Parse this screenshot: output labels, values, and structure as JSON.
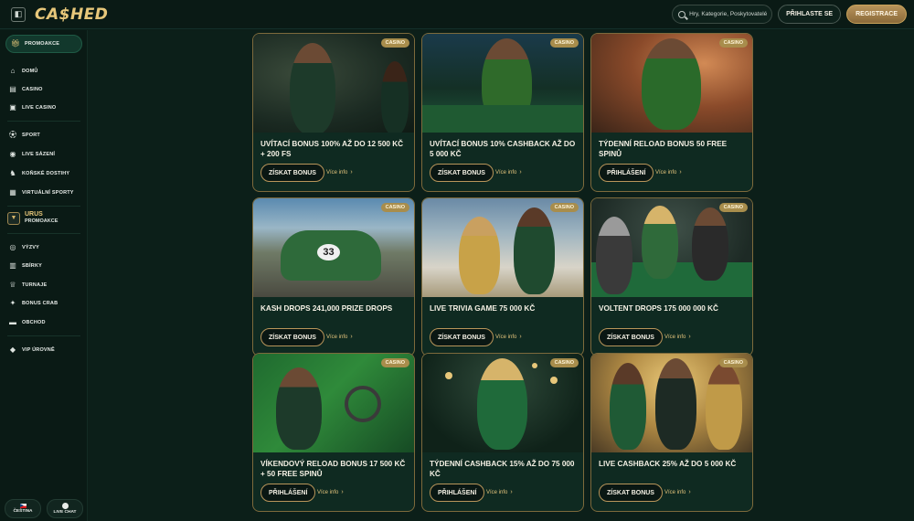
{
  "header": {
    "logo": "CA$HED",
    "search_placeholder": "Hry, Kategorie, Poskytovatelé",
    "login_label": "PŘIHLASTE SE",
    "register_label": "REGISTRACE"
  },
  "sidebar": {
    "promo_label": "PROMOAKCE",
    "items": [
      {
        "label": "DOMŮ",
        "icon": "home-icon"
      },
      {
        "label": "CASINO",
        "icon": "cards-icon"
      },
      {
        "label": "LIVE CASINO",
        "icon": "live-casino-icon"
      },
      {
        "label": "SPORT",
        "icon": "ball-icon"
      },
      {
        "label": "LIVE SÁZENÍ",
        "icon": "live-bet-icon"
      },
      {
        "label": "KOŇSKÉ DOSTIHY",
        "icon": "horse-icon"
      },
      {
        "label": "VIRTUÁLNÍ SPORTY",
        "icon": "virtual-sports-icon"
      }
    ],
    "urus": {
      "title": "URUS",
      "subtitle": "PROMOAKCE"
    },
    "items2": [
      {
        "label": "VÝZVY",
        "icon": "challenge-icon"
      },
      {
        "label": "SBÍRKY",
        "icon": "collection-icon"
      },
      {
        "label": "TURNAJE",
        "icon": "trophy-icon"
      },
      {
        "label": "BONUS CRAB",
        "icon": "crab-icon"
      },
      {
        "label": "OBCHOD",
        "icon": "shop-icon"
      }
    ],
    "vip_label": "VIP ÚROVNĚ",
    "language_label": "ČEŠTINA",
    "chat_label": "LIVE CHAT"
  },
  "cards": [
    {
      "tag": "CASINO",
      "title": "UVÍTACÍ BONUS 100% AŽ DO 12 500 KČ + 200 FS",
      "cta": "ZÍSKAT BONUS",
      "more": "Více info"
    },
    {
      "tag": "CASINO",
      "title": "UVÍTACÍ BONUS 10% CASHBACK AŽ DO 5 000 KČ",
      "cta": "ZÍSKAT BONUS",
      "more": "Více info"
    },
    {
      "tag": "CASINO",
      "title": "TÝDENNÍ RELOAD BONUS 50 FREE SPINŮ",
      "cta": "PŘIHLÁŠENÍ",
      "more": "Více info"
    },
    {
      "tag": "CASINO",
      "title": "KASH DROPS 241,000 PRIZE DROPS",
      "cta": "ZÍSKAT BONUS",
      "more": "Více info"
    },
    {
      "tag": "CASINO",
      "title": "LIVE TRIVIA GAME 75 000 KČ",
      "cta": "ZÍSKAT BONUS",
      "more": "Více info"
    },
    {
      "tag": "CASINO",
      "title": "VOLTENT DROPS 175 000 000 KČ",
      "cta": "ZÍSKAT BONUS",
      "more": "Více info"
    },
    {
      "tag": "CASINO",
      "title": "VÍKENDOVÝ RELOAD BONUS 17 500 KČ + 50 FREE SPINŮ",
      "cta": "PŘIHLÁŠENÍ",
      "more": "Více info"
    },
    {
      "tag": "CASINO",
      "title": "TÝDENNÍ CASHBACK 15% AŽ DO 75 000 KČ",
      "cta": "PŘIHLÁŠENÍ",
      "more": "Více info"
    },
    {
      "tag": "CASINO",
      "title": "LIVE CASHBACK 25% AŽ DO 5 000 KČ",
      "cta": "ZÍSKAT BONUS",
      "more": "Více info"
    }
  ],
  "colors": {
    "background": "#0b1d17",
    "accent_gold": "#e7c77a",
    "card_border": "#7d6a3c"
  }
}
